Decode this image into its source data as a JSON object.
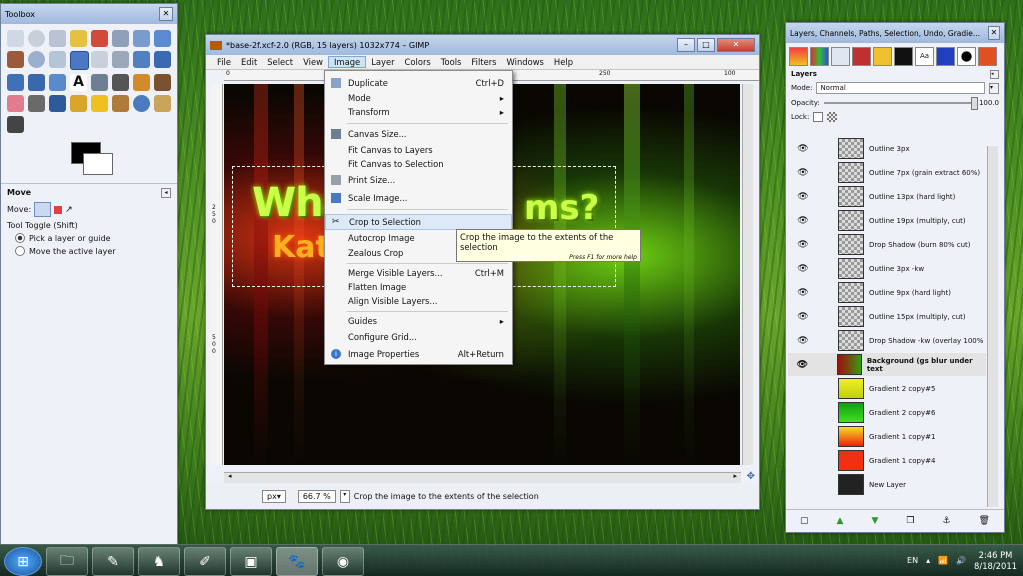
{
  "toolbox": {
    "title": "Toolbox",
    "tool_section_title": "Move",
    "move_label": "Move:",
    "toggle_label": "Tool Toggle  (Shift)",
    "options": [
      "Pick a layer or guide",
      "Move the active layer"
    ]
  },
  "gimp": {
    "title": "*base-2f.xcf-2.0 (RGB, 15 layers) 1032x774 – GIMP",
    "menus": [
      "File",
      "Edit",
      "Select",
      "View",
      "Image",
      "Layer",
      "Colors",
      "Tools",
      "Filters",
      "Windows",
      "Help"
    ],
    "ruler_marks": [
      "0",
      "250",
      "100"
    ],
    "vruler_marks": [
      "2 5 0",
      "5 0 0"
    ],
    "unit": "px▾",
    "zoom": "66.7 %",
    "status": "Crop the image to the extents of the selection",
    "canvas_text1": "What",
    "canvas_text2": "ms?",
    "canvas_text3": "Kat"
  },
  "image_menu": {
    "items": [
      {
        "label": "Duplicate",
        "shortcut": "Ctrl+D"
      },
      {
        "label": "Mode",
        "shortcut": "▸"
      },
      {
        "label": "Transform",
        "shortcut": "▸"
      },
      {
        "label": "Canvas Size...",
        "shortcut": ""
      },
      {
        "label": "Fit Canvas to Layers",
        "shortcut": ""
      },
      {
        "label": "Fit Canvas to Selection",
        "shortcut": ""
      },
      {
        "label": "Print Size...",
        "shortcut": ""
      },
      {
        "label": "Scale Image...",
        "shortcut": ""
      },
      {
        "label": "Crop to Selection",
        "shortcut": ""
      },
      {
        "label": "Autocrop Image",
        "shortcut": ""
      },
      {
        "label": "Zealous Crop",
        "shortcut": ""
      },
      {
        "label": "Merge Visible Layers...",
        "shortcut": "Ctrl+M"
      },
      {
        "label": "Flatten Image",
        "shortcut": ""
      },
      {
        "label": "Align Visible Layers...",
        "shortcut": ""
      },
      {
        "label": "Guides",
        "shortcut": "▸"
      },
      {
        "label": "Configure Grid...",
        "shortcut": ""
      },
      {
        "label": "Image Properties",
        "shortcut": "Alt+Return"
      }
    ]
  },
  "tooltip": {
    "text": "Crop the image to the extents of the selection",
    "help": "Press F1 for more help"
  },
  "layers": {
    "title": "Layers, Channels, Paths, Selection, Undo, Gradie...",
    "panel_label": "Layers",
    "mode_label": "Mode:",
    "mode_value": "Normal",
    "opacity_label": "Opacity:",
    "opacity_value": "100.0",
    "lock_label": "Lock:",
    "list": [
      {
        "name": "Outline 3px",
        "visible": true
      },
      {
        "name": "Outline 7px (grain extract 60%)",
        "visible": true
      },
      {
        "name": "Outline 13px (hard light)",
        "visible": true
      },
      {
        "name": "Outline 19px (multiply, cut)",
        "visible": true
      },
      {
        "name": "Drop Shadow (burn 80% cut)",
        "visible": true
      },
      {
        "name": "Outline 3px -kw",
        "visible": true
      },
      {
        "name": "Outline 9px (hard light)",
        "visible": true
      },
      {
        "name": "Outline 15px (multiply, cut)",
        "visible": true
      },
      {
        "name": "Drop Shadow -kw (overlay 100%",
        "visible": true
      },
      {
        "name": "Background (gs blur under text",
        "visible": true
      },
      {
        "name": "Gradient 2 copy#5",
        "visible": false
      },
      {
        "name": "Gradient 2 copy#6",
        "visible": false
      },
      {
        "name": "Gradient 1 copy#1",
        "visible": false
      },
      {
        "name": "Gradient 1 copy#4",
        "visible": false
      },
      {
        "name": "New Layer",
        "visible": false
      }
    ]
  },
  "taskbar": {
    "lang": "EN",
    "time": "2:46 PM",
    "date": "8/18/2011"
  }
}
